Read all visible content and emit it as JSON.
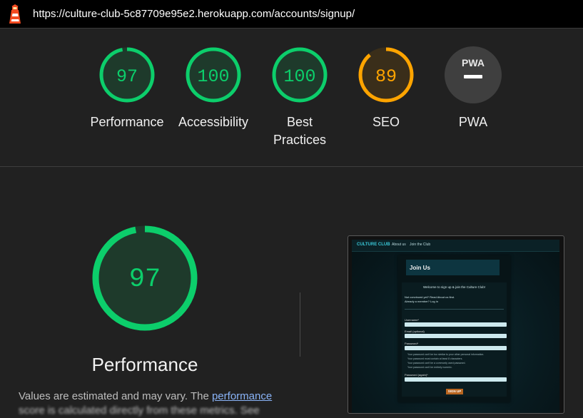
{
  "topbar": {
    "url": "https://culture-club-5c87709e95e2.herokuapp.com/accounts/signup/"
  },
  "gauges": [
    {
      "score": "97",
      "label": "Performance",
      "status": "pass"
    },
    {
      "score": "100",
      "label": "Accessibility",
      "status": "pass"
    },
    {
      "score": "100",
      "label": "Best",
      "label2": "Practices",
      "status": "pass"
    },
    {
      "score": "89",
      "label": "SEO",
      "status": "average"
    },
    {
      "badge": "PWA",
      "label": "PWA",
      "status": "na"
    }
  ],
  "performance": {
    "score": "97",
    "title": "Performance",
    "desc_prefix": "Values are estimated and may vary. The ",
    "desc_link": "performance",
    "desc_tail": "score is calculated directly from these metrics. See"
  },
  "thumbnail": {
    "brand": "CULTURE CLUB",
    "nav_about": "About us",
    "nav_join": "Join the Club",
    "heading": "Join Us",
    "welcome": "Welcome to sign up & join the Culture Club!",
    "intro": "Not convinced yet? Read About us first.",
    "already": "Already a member? Log in",
    "username_label": "Username*",
    "email_label": "Email (optional)",
    "password_label": "Password*",
    "password2_label": "Password (again)*",
    "hint1": "Your password can't be too similar to your other personal information.",
    "hint2": "Your password must contain at least 8 characters.",
    "hint3": "Your password can't be a commonly used password.",
    "hint4": "Your password can't be entirely numeric.",
    "button": "SIGN UP"
  },
  "colors": {
    "pass": "#0cce6b",
    "average": "#ffa400",
    "pass_fill": "#1e3a2b",
    "average_fill": "#3a2e1a",
    "na": "#3f3f3f"
  }
}
